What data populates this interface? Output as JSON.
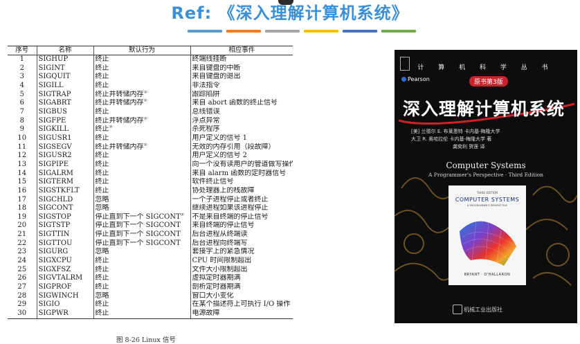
{
  "header": {
    "title": "Ref: 《深入理解计算机系统》",
    "bar_colors": [
      "#5b9bd5",
      "#ed7d31",
      "#a5a5a5",
      "#ffc000",
      "#4472c4",
      "#70ad47"
    ]
  },
  "table": {
    "columns": [
      "序号",
      "名称",
      "默认行为",
      "相应事件"
    ],
    "rows": [
      {
        "num": "1",
        "name": "SIGHUP",
        "action": "终止",
        "note": "",
        "event": "终端线挂断"
      },
      {
        "num": "2",
        "name": "SIGINT",
        "action": "终止",
        "note": "",
        "event": "来自键盘的中断"
      },
      {
        "num": "3",
        "name": "SIGQUIT",
        "action": "终止",
        "note": "",
        "event": "来自键盘的退出"
      },
      {
        "num": "4",
        "name": "SIGILL",
        "action": "终止",
        "note": "",
        "event": "非法指令"
      },
      {
        "num": "5",
        "name": "SIGTRAP",
        "action": "终止并转储内存",
        "note": "①",
        "event": "跟踪陷阱"
      },
      {
        "num": "6",
        "name": "SIGABRT",
        "action": "终止并转储内存",
        "note": "①",
        "event": "来自 abort 函数的终止信号"
      },
      {
        "num": "7",
        "name": "SIGBUS",
        "action": "终止",
        "note": "",
        "event": "总线错误"
      },
      {
        "num": "8",
        "name": "SIGFPE",
        "action": "终止并转储内存",
        "note": "①",
        "event": "浮点异常"
      },
      {
        "num": "9",
        "name": "SIGKILL",
        "action": "终止",
        "note": "②",
        "event": "杀死程序"
      },
      {
        "num": "10",
        "name": "SIGUSR1",
        "action": "终止",
        "note": "",
        "event": "用户定义的信号 1"
      },
      {
        "num": "11",
        "name": "SIGSEGV",
        "action": "终止并转储内存",
        "note": "①",
        "event": "无效的内存引用（段故障）"
      },
      {
        "num": "12",
        "name": "SIGUSR2",
        "action": "终止",
        "note": "",
        "event": "用户定义的信号 2"
      },
      {
        "num": "13",
        "name": "SIGPIPE",
        "action": "终止",
        "note": "",
        "event": "向一个没有读用户的管道做写操作"
      },
      {
        "num": "14",
        "name": "SIGALRM",
        "action": "终止",
        "note": "",
        "event": "来自 alarm 函数的定时器信号"
      },
      {
        "num": "15",
        "name": "SIGTERM",
        "action": "终止",
        "note": "",
        "event": "软件终止信号"
      },
      {
        "num": "16",
        "name": "SIGSTKFLT",
        "action": "终止",
        "note": "",
        "event": "协处理器上的栈故障"
      },
      {
        "num": "17",
        "name": "SIGCHLD",
        "action": "忽略",
        "note": "",
        "event": "一个子进程停止或者终止"
      },
      {
        "num": "18",
        "name": "SIGCONT",
        "action": "忽略",
        "note": "",
        "event": "继续进程如果该进程停止"
      },
      {
        "num": "19",
        "name": "SIGSTOP",
        "action": "停止直到下一个 SIGCONT",
        "note": "②",
        "event": "不是来自终端的停止信号"
      },
      {
        "num": "20",
        "name": "SIGTSTP",
        "action": "停止直到下一个 SIGCONT",
        "note": "",
        "event": "来自终端的停止信号"
      },
      {
        "num": "21",
        "name": "SIGTTIN",
        "action": "停止直到下一个 SIGCONT",
        "note": "",
        "event": "后台进程从终端读"
      },
      {
        "num": "22",
        "name": "SIGTTOU",
        "action": "停止直到下一个 SIGCONT",
        "note": "",
        "event": "后台进程向终端写"
      },
      {
        "num": "23",
        "name": "SIGURG",
        "action": "忽略",
        "note": "",
        "event": "套接字上的紧急情况"
      },
      {
        "num": "24",
        "name": "SIGXCPU",
        "action": "终止",
        "note": "",
        "event": "CPU 时间限制超出"
      },
      {
        "num": "25",
        "name": "SIGXFSZ",
        "action": "终止",
        "note": "",
        "event": "文件大小限制超出"
      },
      {
        "num": "26",
        "name": "SIGVTALRM",
        "action": "终止",
        "note": "",
        "event": "虚拟定时器期满"
      },
      {
        "num": "27",
        "name": "SIGPROF",
        "action": "终止",
        "note": "",
        "event": "剖析定时器期满"
      },
      {
        "num": "28",
        "name": "SIGWINCH",
        "action": "忽略",
        "note": "",
        "event": "窗口大小变化"
      },
      {
        "num": "29",
        "name": "SIGIO",
        "action": "终止",
        "note": "",
        "event": "在某个描述符上可执行 I/O 操作"
      },
      {
        "num": "30",
        "name": "SIGPWR",
        "action": "终止",
        "note": "",
        "event": "电源故障"
      }
    ],
    "caption": "图 8-26   Linux 信号"
  },
  "book": {
    "series": "计 算 机 科 学 丛 书",
    "publisher_brand": "Pearson",
    "edition_badge": "原书第3版",
    "title_cn": "深入理解计算机系统",
    "authors_lines": [
      "[美]  兰德尔 E. 布莱恩特  卡内基-梅隆大学",
      "大卫 R. 奥哈拉伦  卡内基-梅隆大学   著",
      "龚奕利  贺莲  译"
    ],
    "title_en": "Computer Systems",
    "subtitle_en": "A Programmer's Perspective · Third Edition",
    "inner_edition": "THIRD EDITION",
    "inner_title": "COMPUTER SYSTEMS",
    "inner_subtitle": "A PROGRAMMER'S PERSPECTIVE",
    "inner_authors": "BRYANT · O'HALLARON",
    "publisher": "机械工业出版社"
  }
}
